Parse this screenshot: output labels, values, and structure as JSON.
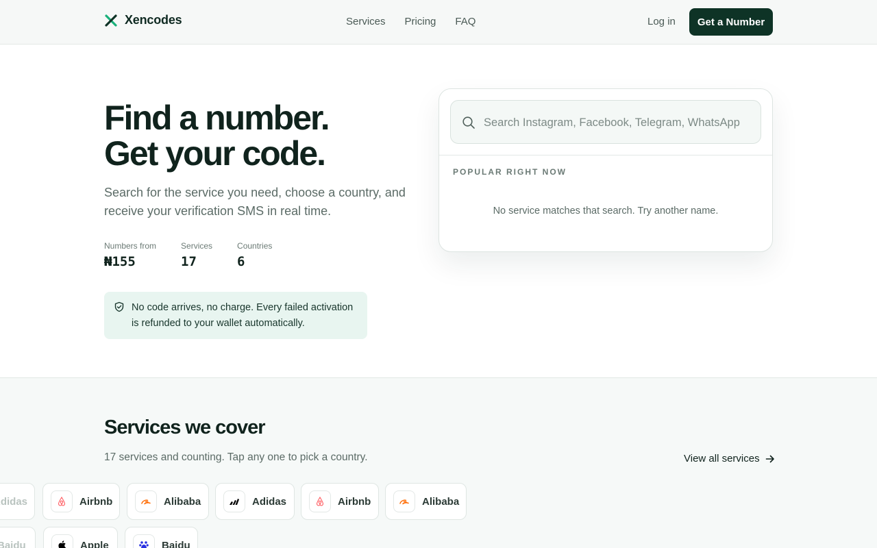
{
  "nav": {
    "brand": "Xencodes",
    "links": [
      "Services",
      "Pricing",
      "FAQ"
    ],
    "login": "Log in",
    "cta": "Get a Number"
  },
  "hero": {
    "title_line1": "Find a number.",
    "title_line2": "Get your code.",
    "subtitle": "Search for the service you need, choose a country, and receive your verification SMS in real time.",
    "stats": [
      {
        "label": "Numbers from",
        "value": "₦155"
      },
      {
        "label": "Services",
        "value": "17"
      },
      {
        "label": "Countries",
        "value": "6"
      }
    ],
    "refund_note": "No code arrives, no charge. Every failed activation is refunded to your wallet automatically."
  },
  "search": {
    "placeholder": "Search Instagram, Facebook, Telegram, WhatsApp",
    "value": "",
    "popular_label": "POPULAR RIGHT NOW",
    "empty_message": "No service matches that search. Try another name."
  },
  "services": {
    "title": "Services we cover",
    "subtitle": "17 services and counting. Tap any one to pick a country.",
    "view_all": "View all services",
    "row1": [
      {
        "label": "Adidas",
        "icon": "adidas-icon",
        "faded": true
      },
      {
        "label": "Airbnb",
        "icon": "airbnb-icon"
      },
      {
        "label": "Alibaba",
        "icon": "alibaba-icon"
      },
      {
        "label": "Adidas",
        "icon": "adidas-icon"
      },
      {
        "label": "Airbnb",
        "icon": "airbnb-icon"
      },
      {
        "label": "Alibaba",
        "icon": "alibaba-icon"
      }
    ],
    "row2": [
      {
        "label": "Baidu",
        "icon": "baidu-icon",
        "faded": true
      },
      {
        "label": "Apple",
        "icon": "apple-icon"
      },
      {
        "label": "Baidu",
        "icon": "baidu-icon"
      }
    ]
  },
  "colors": {
    "brand_dark": "#0e3326",
    "brand_accent": "#19b07a",
    "refund_bg": "#e8f5f0",
    "airbnb": "#ff5a5f",
    "alibaba": "#ff6a00",
    "baidu": "#2932e1"
  }
}
